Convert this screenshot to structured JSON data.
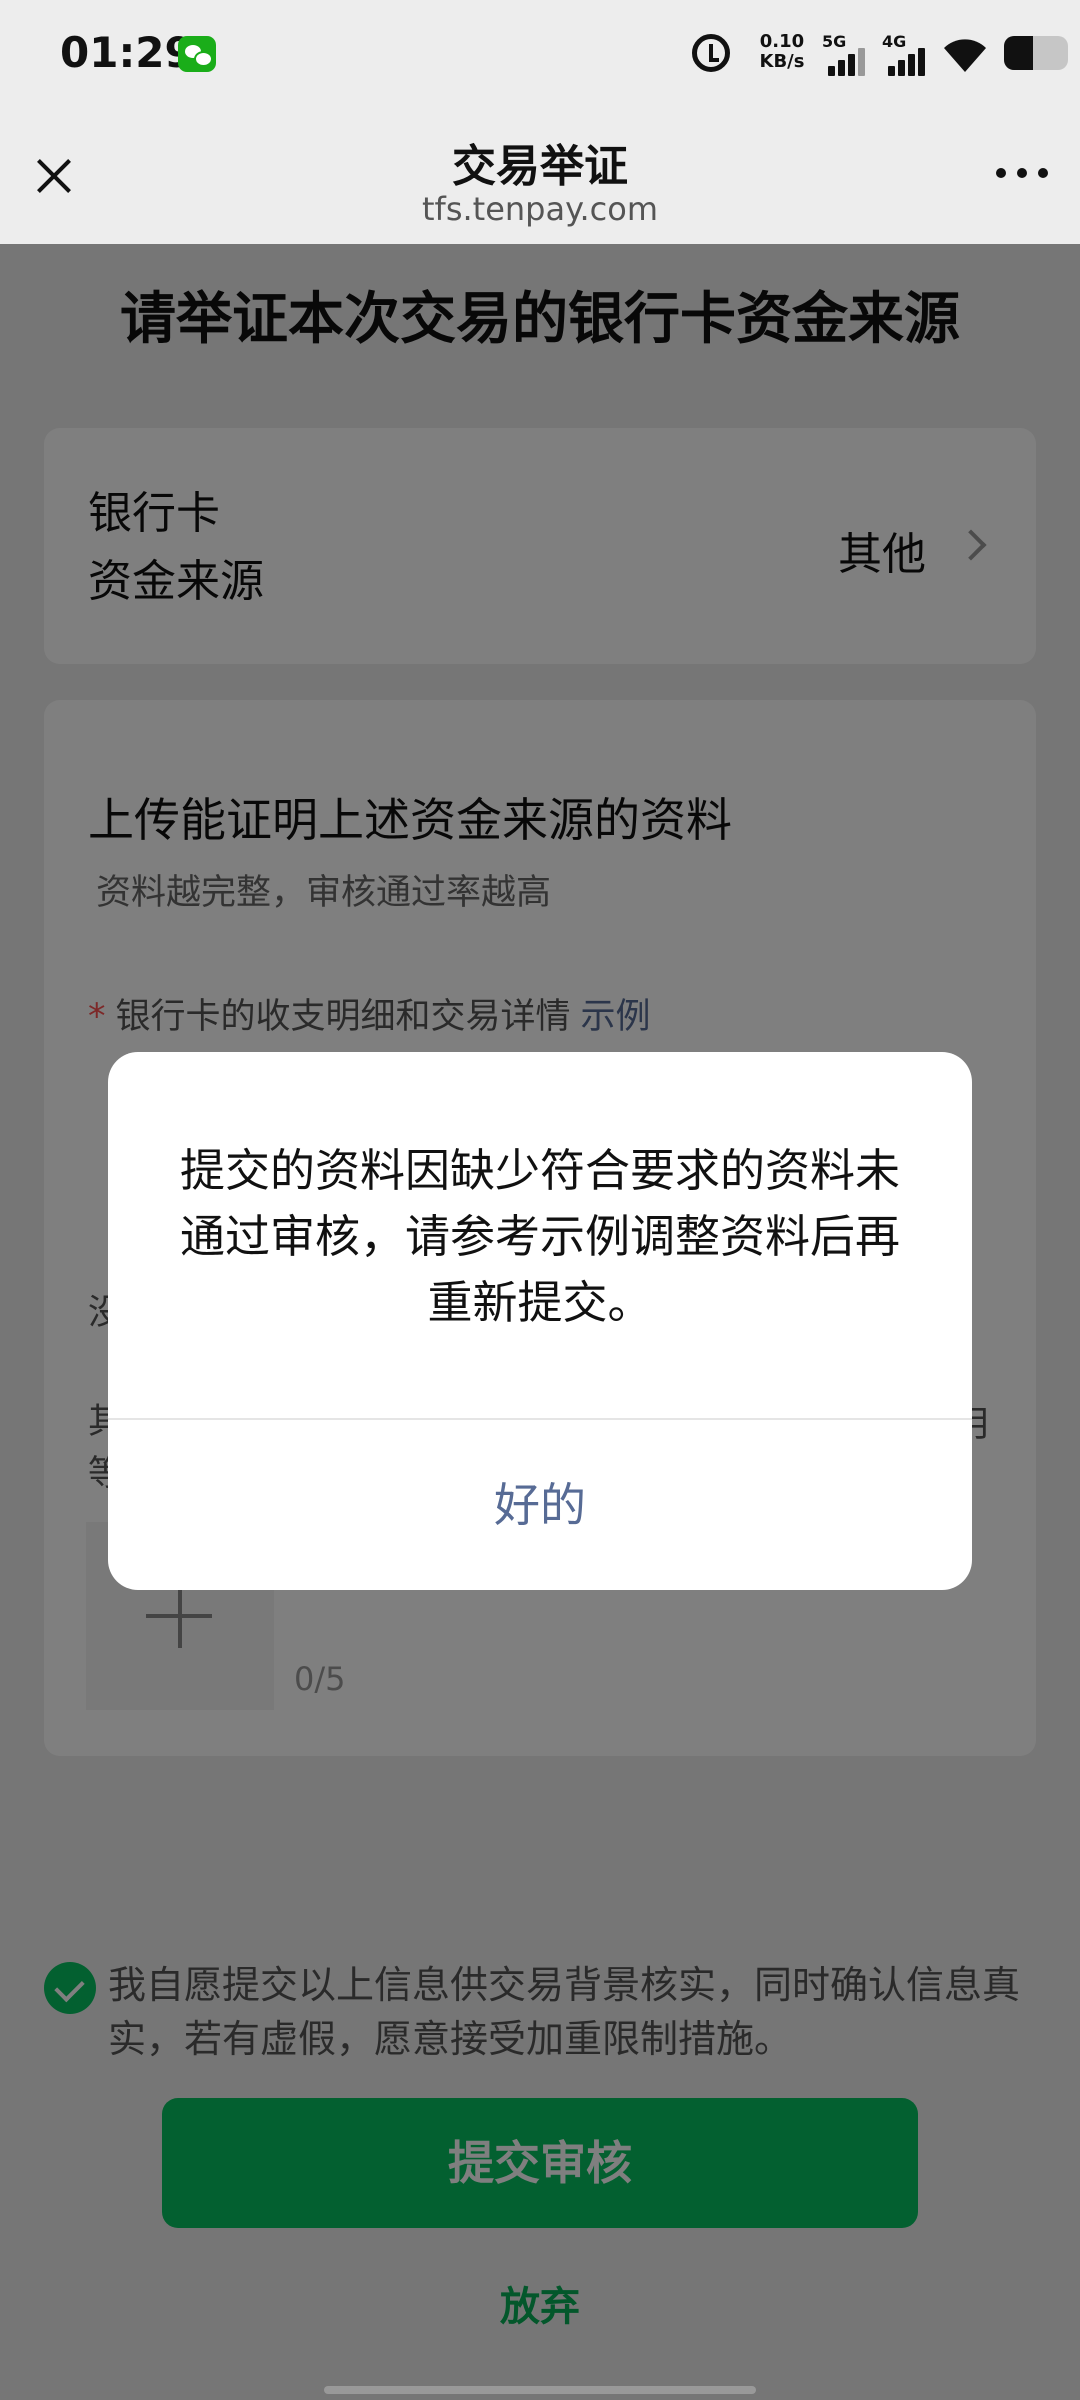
{
  "status_bar": {
    "time": "01:29",
    "net_speed_value": "0.10",
    "net_speed_unit": "KB/s",
    "signal_1_label": "5G",
    "signal_2_label": "4G",
    "battery_level": 0.45,
    "icons": [
      "wechat-icon",
      "alarm-icon",
      "signal-icon",
      "wifi-icon",
      "battery-icon"
    ]
  },
  "nav": {
    "title": "交易举证",
    "subtitle": "tfs.tenpay.com"
  },
  "page": {
    "title": "请举证本次交易的银行卡资金来源",
    "source_row": {
      "label_line1": "银行卡",
      "label_line2": "资金来源",
      "value": "其他"
    },
    "upload": {
      "title": "上传能证明上述资金来源的资料",
      "subtitle": "资料越完整，审核通过率越高",
      "required_star": "*",
      "required_label": "银行卡的收支明细和交易详情",
      "example_link": "示例",
      "partial_a": "没",
      "partial_b": "其\n等",
      "partial_c": "月",
      "count": "0/5"
    },
    "consent_text": "我自愿提交以上信息供交易背景核实，同时确认信息真实，若有虚假，愿意接受加重限制措施。",
    "submit_label": "提交审核",
    "abandon_label": "放弃"
  },
  "dialog": {
    "message": "提交的资料因缺少符合要求的资料未通过审核，请参考示例调整资料后再重新提交。",
    "ok_label": "好的"
  },
  "colors": {
    "primary_green": "#07c160",
    "link_blue": "#576b95",
    "required_red": "#fa5151",
    "background": "#ededed"
  }
}
